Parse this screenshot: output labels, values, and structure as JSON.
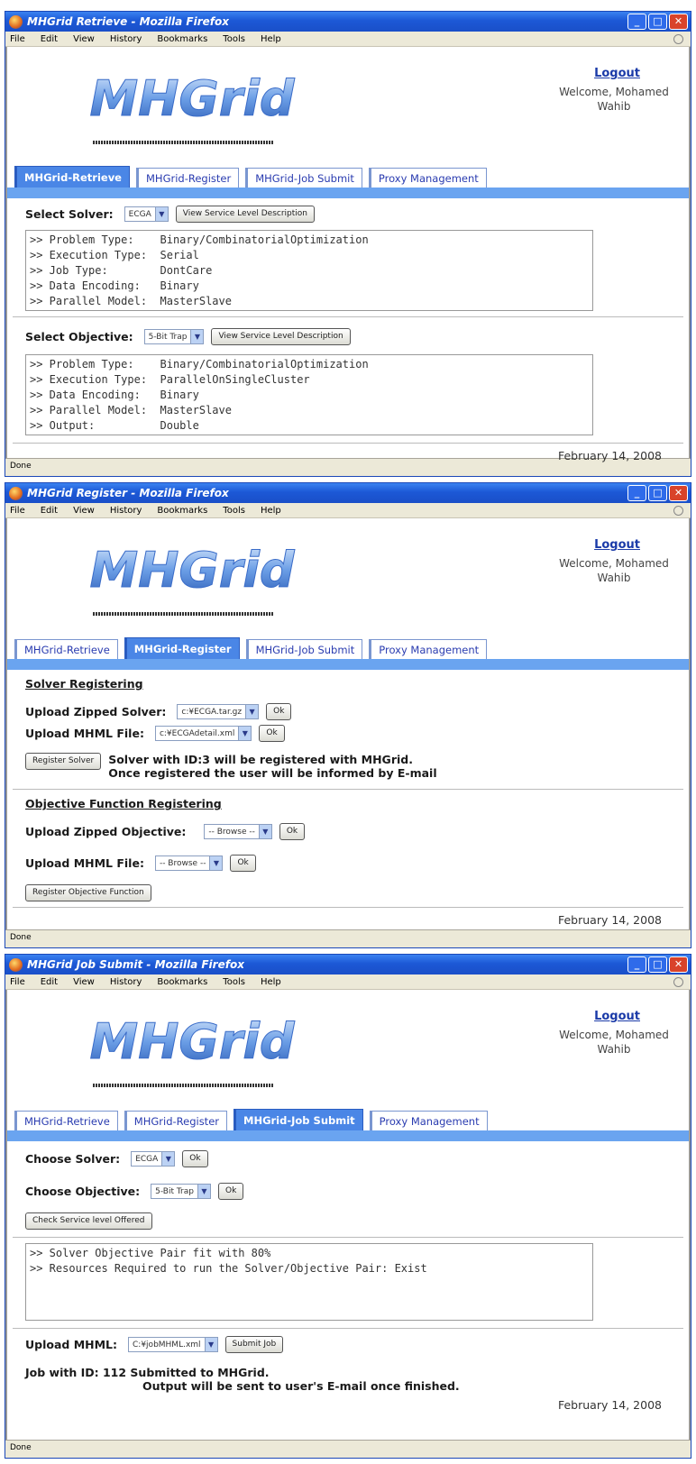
{
  "windows": [
    {
      "title": "MHGrid Retrieve - Mozilla Firefox",
      "status": "Done"
    },
    {
      "title": "MHGrid Register - Mozilla Firefox",
      "status": "Done"
    },
    {
      "title": "MHGrid Job Submit - Mozilla Firefox",
      "status": "Done"
    }
  ],
  "menu": {
    "file": "File",
    "edit": "Edit",
    "view": "View",
    "history": "History",
    "bookmarks": "Bookmarks",
    "tools": "Tools",
    "help": "Help"
  },
  "header": {
    "logo": "MHGrid",
    "logout": "Logout",
    "welcome": "Welcome, Mohamed Wahib"
  },
  "tabs": {
    "retrieve": "MHGrid-Retrieve",
    "register": "MHGrid-Register",
    "submit": "MHGrid-Job Submit",
    "proxy": "Proxy Management"
  },
  "date": "February 14, 2008",
  "retrieve": {
    "solver_label": "Select Solver:",
    "solver_value": "ECGA",
    "solver_btn": "View Service Level Description",
    "solver_info": ">> Problem Type:    Binary/CombinatorialOptimization\n>> Execution Type:  Serial\n>> Job Type:        DontCare\n>> Data Encoding:   Binary\n>> Parallel Model:  MasterSlave",
    "objective_label": "Select Objective:",
    "objective_value": "5-Bit Trap",
    "objective_btn": "View Service Level Description",
    "objective_info": ">> Problem Type:    Binary/CombinatorialOptimization\n>> Execution Type:  ParallelOnSingleCluster\n>> Data Encoding:   Binary\n>> Parallel Model:  MasterSlave\n>> Output:          Double"
  },
  "register": {
    "solver_head": "Solver Registering",
    "zip_solver_label": "Upload Zipped Solver:",
    "zip_solver_value": "c:¥ECGA.tar.gz",
    "ok": "Ok",
    "mhml_label": "Upload MHML File:",
    "mhml_solver_value": "c:¥ECGAdetail.xml",
    "register_solver_btn": "Register Solver",
    "solver_msg1": "Solver with ID:3 will be registered with MHGrid.",
    "solver_msg2": "Once registered the user will be informed by E-mail",
    "objective_head": "Objective Function Registering",
    "zip_obj_label": "Upload Zipped Objective:",
    "browse": "-- Browse --",
    "register_obj_btn": "Register Objective Function"
  },
  "submit": {
    "solver_label": "Choose Solver:",
    "solver_value": "ECGA",
    "ok": "Ok",
    "objective_label": "Choose Objective:",
    "objective_value": "5-Bit Trap",
    "check_btn": "Check Service level Offered",
    "info": ">> Solver Objective Pair fit with 80%\n>> Resources Required to run the Solver/Objective Pair: Exist",
    "upload_label": "Upload MHML:",
    "upload_value": "C:¥jobMHML.xml",
    "submit_btn": "Submit Job",
    "msg1": "Job with ID: 112 Submitted to MHGrid.",
    "msg2": "Output will be sent to user's E-mail once finished."
  }
}
